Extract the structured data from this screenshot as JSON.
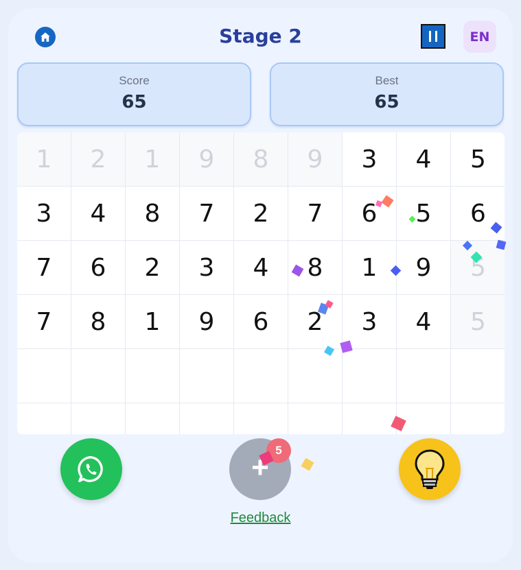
{
  "header": {
    "title": "Stage 2",
    "language": "EN"
  },
  "stats": {
    "score_label": "Score",
    "score_value": "65",
    "best_label": "Best",
    "best_value": "65"
  },
  "board": {
    "rows": [
      [
        {
          "v": "1",
          "used": true
        },
        {
          "v": "2",
          "used": true
        },
        {
          "v": "1",
          "used": true
        },
        {
          "v": "9",
          "used": true
        },
        {
          "v": "8",
          "used": true
        },
        {
          "v": "9",
          "used": true
        },
        {
          "v": "3",
          "used": false
        },
        {
          "v": "4",
          "used": false
        },
        {
          "v": "5",
          "used": false
        }
      ],
      [
        {
          "v": "3",
          "used": false
        },
        {
          "v": "4",
          "used": false
        },
        {
          "v": "8",
          "used": false
        },
        {
          "v": "7",
          "used": false
        },
        {
          "v": "2",
          "used": false
        },
        {
          "v": "7",
          "used": false
        },
        {
          "v": "6",
          "used": false
        },
        {
          "v": "5",
          "used": false
        },
        {
          "v": "6",
          "used": false
        }
      ],
      [
        {
          "v": "7",
          "used": false
        },
        {
          "v": "6",
          "used": false
        },
        {
          "v": "2",
          "used": false
        },
        {
          "v": "3",
          "used": false
        },
        {
          "v": "4",
          "used": false
        },
        {
          "v": "8",
          "used": false
        },
        {
          "v": "1",
          "used": false
        },
        {
          "v": "9",
          "used": false
        },
        {
          "v": "5",
          "used": true
        }
      ],
      [
        {
          "v": "7",
          "used": false
        },
        {
          "v": "8",
          "used": false
        },
        {
          "v": "1",
          "used": false
        },
        {
          "v": "9",
          "used": false
        },
        {
          "v": "6",
          "used": false
        },
        {
          "v": "2",
          "used": false
        },
        {
          "v": "3",
          "used": false
        },
        {
          "v": "4",
          "used": false
        },
        {
          "v": "5",
          "used": true
        }
      ],
      [
        {
          "v": "",
          "used": false
        },
        {
          "v": "",
          "used": false
        },
        {
          "v": "",
          "used": false
        },
        {
          "v": "",
          "used": false
        },
        {
          "v": "",
          "used": false
        },
        {
          "v": "",
          "used": false
        },
        {
          "v": "",
          "used": false
        },
        {
          "v": "",
          "used": false
        },
        {
          "v": "",
          "used": false
        }
      ],
      [
        {
          "v": "",
          "used": false
        },
        {
          "v": "",
          "used": false
        },
        {
          "v": "",
          "used": false
        },
        {
          "v": "",
          "used": false
        },
        {
          "v": "",
          "used": false
        },
        {
          "v": "",
          "used": false
        },
        {
          "v": "",
          "used": false
        },
        {
          "v": "",
          "used": false
        },
        {
          "v": "",
          "used": false
        }
      ]
    ]
  },
  "actions": {
    "add_badge": "5",
    "feedback_label": "Feedback"
  },
  "icons": {
    "home": "home-icon",
    "pause": "pause-icon",
    "share": "whatsapp-icon",
    "add": "plus-icon",
    "hint": "lightbulb-icon"
  },
  "colors": {
    "title": "#2a3f9c",
    "share": "#23c15b",
    "hint": "#f7c21a",
    "badge": "#ef6b78",
    "feedback": "#1e8a3c"
  }
}
